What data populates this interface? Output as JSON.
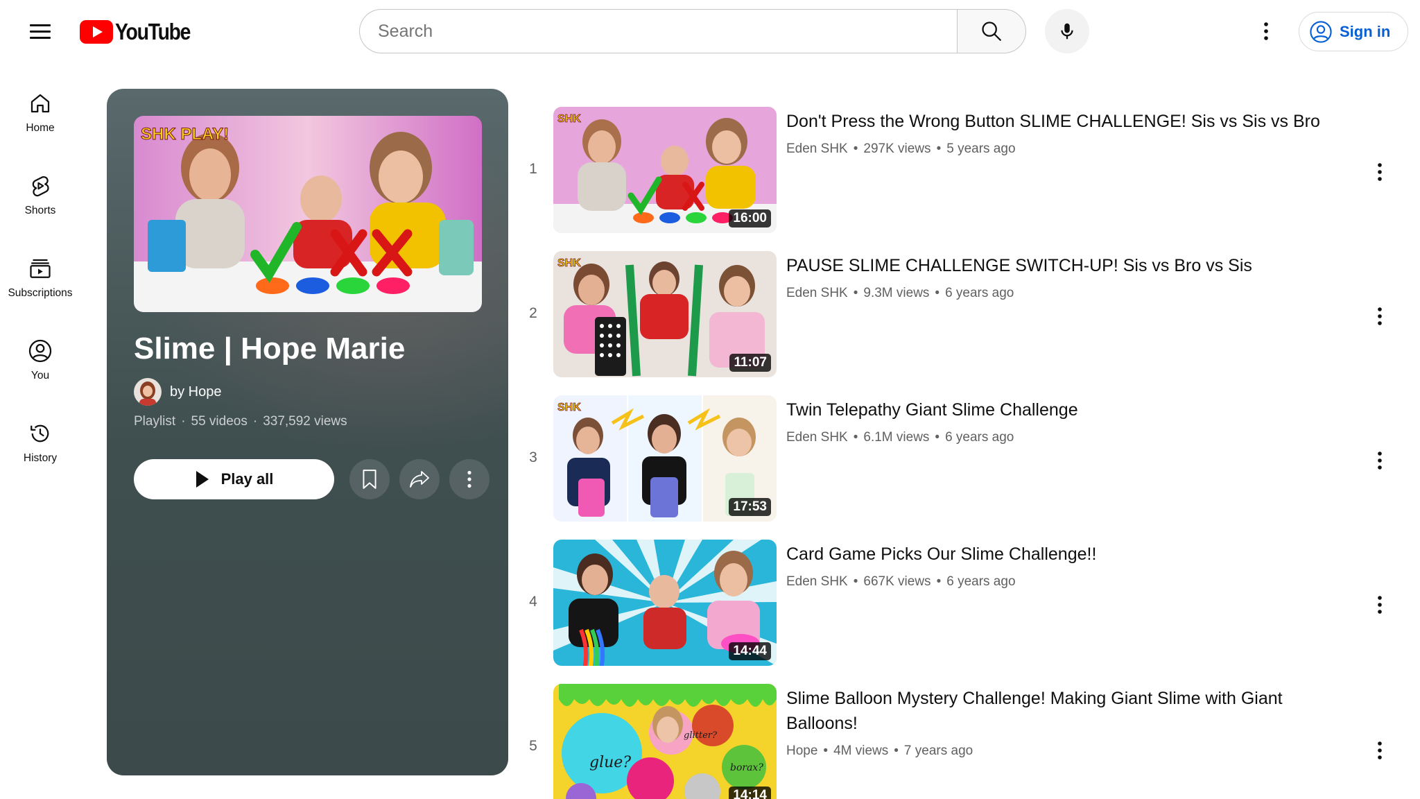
{
  "header": {
    "logo_text": "YouTube",
    "search_placeholder": "Search",
    "sign_in_label": "Sign in"
  },
  "sidebar": {
    "items": [
      {
        "label": "Home",
        "icon": "home-icon"
      },
      {
        "label": "Shorts",
        "icon": "shorts-icon"
      },
      {
        "label": "Subscriptions",
        "icon": "subscriptions-icon"
      },
      {
        "label": "You",
        "icon": "you-icon"
      },
      {
        "label": "History",
        "icon": "history-icon"
      }
    ]
  },
  "playlist": {
    "title": "Slime | Hope Marie",
    "owner": "by Hope",
    "type": "Playlist",
    "video_count": "55 videos",
    "views": "337,592 views",
    "play_all_label": "Play all",
    "thumbnail_badge": "SHK PLAY!"
  },
  "videos": [
    {
      "index": "1",
      "title": "Don't Press the Wrong Button SLIME CHALLENGE! Sis vs Sis vs Bro",
      "channel": "Eden SHK",
      "views": "297K views",
      "age": "5 years ago",
      "duration": "16:00"
    },
    {
      "index": "2",
      "title": "PAUSE SLIME CHALLENGE SWITCH-UP! Sis vs Bro vs Sis",
      "channel": "Eden SHK",
      "views": "9.3M views",
      "age": "6 years ago",
      "duration": "11:07"
    },
    {
      "index": "3",
      "title": "Twin Telepathy Giant Slime Challenge",
      "channel": "Eden SHK",
      "views": "6.1M views",
      "age": "6 years ago",
      "duration": "17:53"
    },
    {
      "index": "4",
      "title": "Card Game Picks Our Slime Challenge!!",
      "channel": "Eden SHK",
      "views": "667K views",
      "age": "6 years ago",
      "duration": "14:44"
    },
    {
      "index": "5",
      "title": "Slime Balloon Mystery Challenge! Making Giant Slime with Giant Balloons!",
      "channel": "Hope",
      "views": "4M views",
      "age": "7 years ago",
      "duration": "14:14"
    }
  ],
  "colors": {
    "brand_red": "#ff0000",
    "link_blue": "#065fd4",
    "card_bg": "#3f4e4f"
  }
}
